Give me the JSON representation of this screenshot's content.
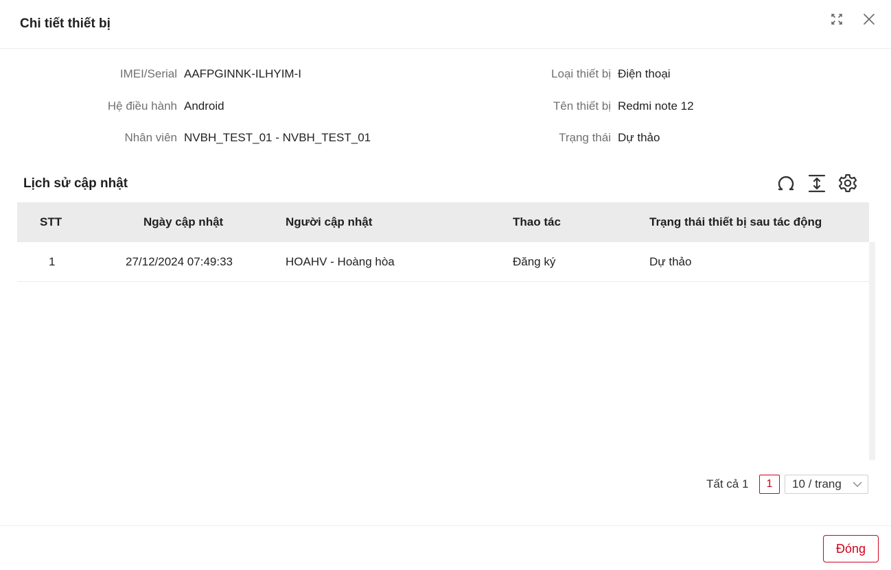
{
  "dialog": {
    "title": "Chi tiết thiết bị",
    "expand_icon": "expand-icon",
    "close_icon": "close-icon"
  },
  "info": {
    "left": [
      {
        "label": "IMEI/Serial",
        "value": "AAFPGINNK-ILHYIM-I"
      },
      {
        "label": "Hệ điều hành",
        "value": "Android"
      },
      {
        "label": "Nhân viên",
        "value": "NVBH_TEST_01 - NVBH_TEST_01"
      }
    ],
    "right": [
      {
        "label": "Loại thiết bị",
        "value": "Điện thoại"
      },
      {
        "label": "Tên thiết bị",
        "value": "Redmi note 12"
      },
      {
        "label": "Trạng thái",
        "value": "Dự thảo"
      }
    ]
  },
  "history": {
    "title": "Lịch sử cập nhật",
    "tools": [
      "refresh-icon",
      "row-height-icon",
      "settings-icon"
    ],
    "columns": [
      "STT",
      "Ngày cập nhật",
      "Người cập nhật",
      "Thao tác",
      "Trạng thái thiết bị sau tác động"
    ],
    "rows": [
      [
        "1",
        "27/12/2024 07:49:33",
        "HOAHV - Hoàng hòa",
        "Đăng ký",
        "Dự thảo"
      ]
    ]
  },
  "pagination": {
    "total_text": "Tất cả 1",
    "current_page": "1",
    "page_size": "10 / trang"
  },
  "footer": {
    "close_label": "Đóng"
  },
  "colors": {
    "accent": "#d0021b",
    "header_bg": "#ebebeb"
  }
}
